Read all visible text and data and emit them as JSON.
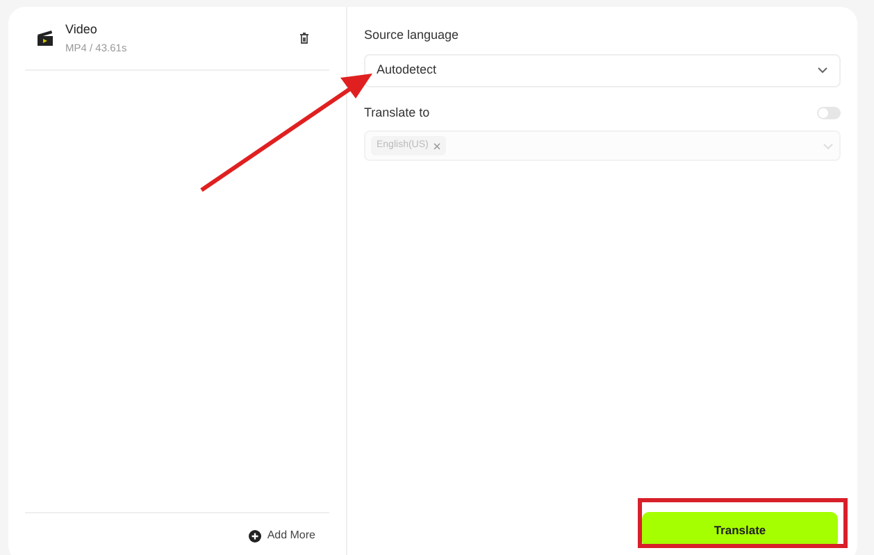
{
  "files": [
    {
      "name": "Video",
      "meta": "MP4 / 43.61s"
    }
  ],
  "add_more": "Add More",
  "source_language": {
    "label": "Source language",
    "value": "Autodetect"
  },
  "translate_to": {
    "label": "Translate to",
    "toggle_on": false,
    "disabled": true,
    "tags": [
      "English(US)"
    ]
  },
  "translate_button": "Translate"
}
